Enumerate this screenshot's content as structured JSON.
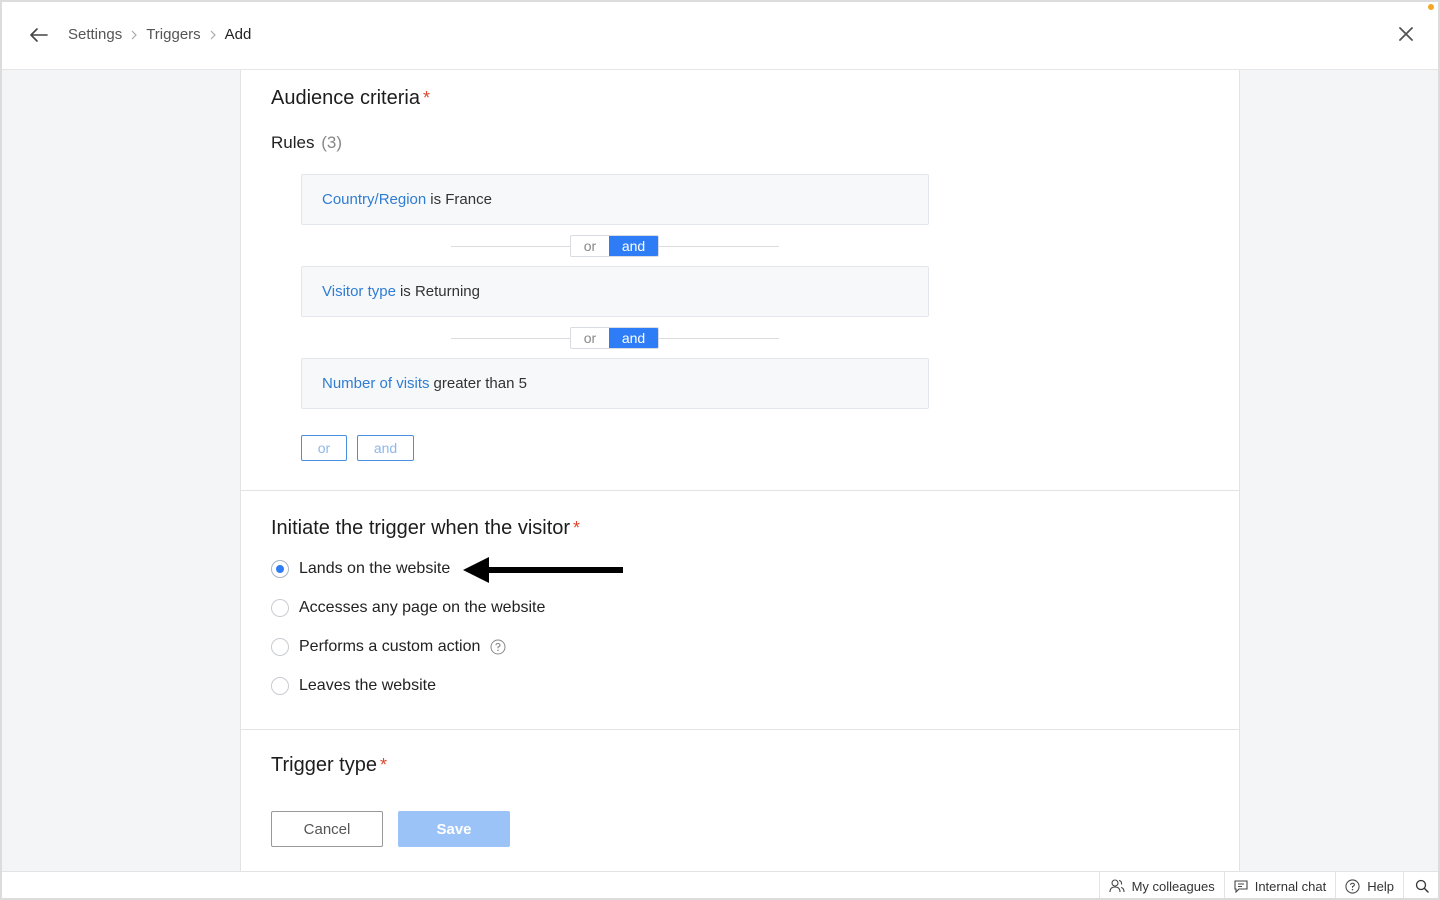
{
  "breadcrumb": [
    "Settings",
    "Triggers",
    "Add"
  ],
  "audience": {
    "title": "Audience criteria",
    "required_mark": "*",
    "rules_label": "Rules",
    "rules_count": "(3)",
    "rules": [
      {
        "field": "Country/Region",
        "condition": "is France"
      },
      {
        "field": "Visitor type",
        "condition": "is Returning"
      },
      {
        "field": "Number of visits",
        "condition": "greater than 5"
      }
    ],
    "connector": {
      "or": "or",
      "and": "and",
      "selected": "and"
    },
    "add_or": "or",
    "add_and": "and"
  },
  "initiate": {
    "title": "Initiate the trigger when the visitor",
    "required_mark": "*",
    "options": [
      {
        "label": "Lands on the website",
        "checked": true
      },
      {
        "label": "Accesses any page on the website",
        "checked": false
      },
      {
        "label": "Performs a custom action",
        "checked": false
      },
      {
        "label": "Leaves the website",
        "checked": false
      }
    ]
  },
  "trigger_type": {
    "title": "Trigger type",
    "required_mark": "*"
  },
  "actions": {
    "cancel": "Cancel",
    "save": "Save"
  },
  "statusbar": {
    "colleagues": "My colleagues",
    "chat": "Internal chat",
    "help": "Help"
  },
  "colors": {
    "accent": "#2f7df6",
    "link": "#2f7dd3",
    "required": "#e0462c",
    "save_disabled": "#9cc3f7"
  },
  "icons": [
    "back-arrow-icon",
    "chevron-right-icon",
    "close-icon",
    "help-circle-icon",
    "pointer-arrow-icon",
    "colleagues-icon",
    "chat-icon",
    "help-icon",
    "search-icon"
  ]
}
